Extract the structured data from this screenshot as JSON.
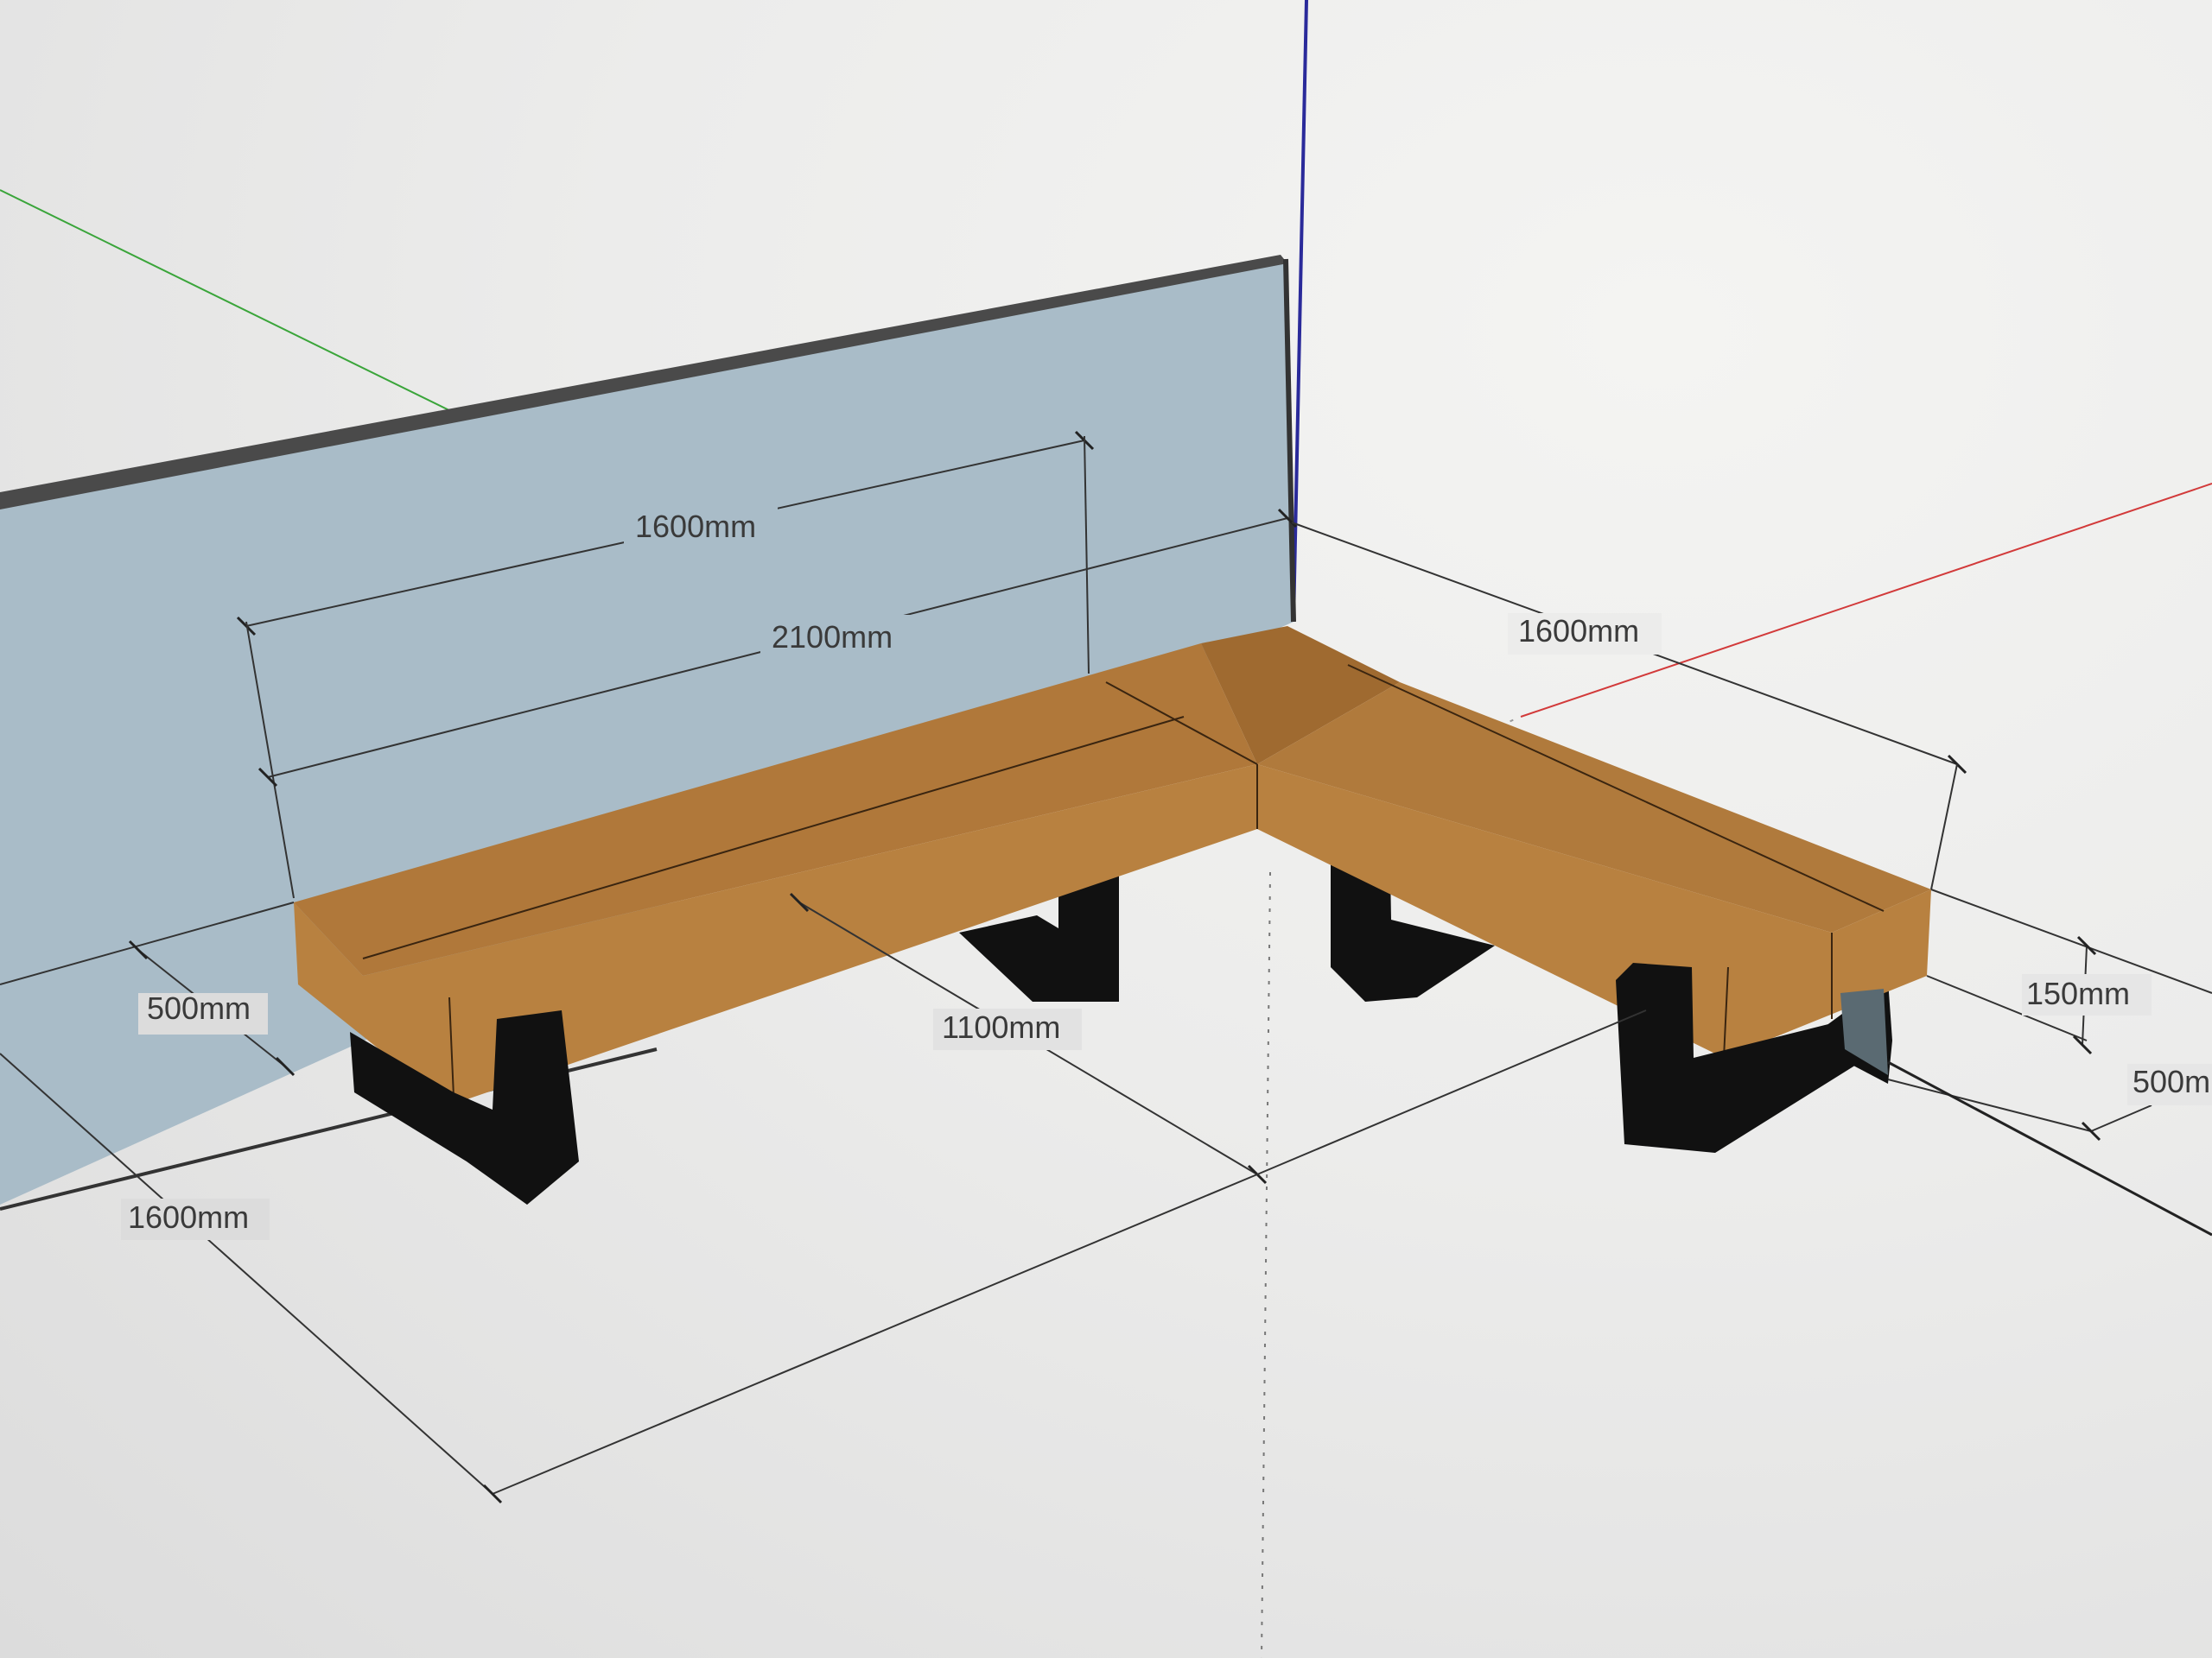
{
  "viewport": {
    "background": "#ececeb",
    "axes": {
      "red_axis_color": "#d23a3a",
      "green_axis_color": "#3aa53a",
      "blue_axis_color": "#2a2a9a"
    }
  },
  "model": {
    "wall_color": "#a9bcc8",
    "wood_color": "#b0783a",
    "leg_color": "#111111"
  },
  "dimensions": {
    "backrest_length": "1600mm",
    "long_seat_length": "2100mm",
    "short_seat_length": "1600mm",
    "seat_depth_left": "500mm",
    "inner_length": "1100mm",
    "seat_thickness": "150mm",
    "seat_depth_right": "500m",
    "floor_length": "1600mm"
  }
}
